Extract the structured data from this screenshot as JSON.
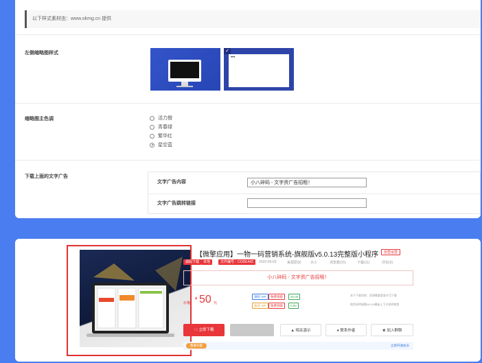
{
  "notice": "以下样式素材由：www.okmg.cn 提供",
  "thumb_style": {
    "label": "左侧缩略图样式"
  },
  "color_setting": {
    "label": "缩略图主色调",
    "options": [
      "活力橙",
      "青春绿",
      "繁华红",
      "星空蓝"
    ],
    "selected": "星空蓝"
  },
  "download_ad": {
    "label": "下载上面的文字广告",
    "content_label": "文字广告内容",
    "content_value": "小八碎码 - 文字资广告招租！",
    "link_label": "文字广告跳转链接",
    "link_value": ""
  },
  "product": {
    "title": "【微擎应用】一物一码营销系统-旗舰版v5.0.13完整版小程序",
    "status_badge": "自营运营",
    "tags": [
      "源码下载",
      "本地",
      "文件编号：CODE443"
    ],
    "meta": [
      "2020-06-03",
      "来源原创",
      "大小",
      "浏览数(25)",
      "下载(11)",
      "评论(0)"
    ],
    "ad_banner": "小八碎码 - 文字资广告招租！",
    "price_label": "价格",
    "price": "50",
    "price_unit": "元",
    "mini_tags": [
      "源码 VIP",
      "免费领取",
      "25.00",
      "会员 VIP",
      "免费领取",
      "0.00"
    ],
    "side_notes": [
      "关于下载须知：资源需要登录才可下载",
      "使用说明请看NO.08模板上下文说明使用"
    ],
    "buttons": [
      "立即下载",
      "",
      "相关演示",
      "联系作者",
      "加入群聊"
    ],
    "footer_chip": "我要升级",
    "footer_link": "立即开通会员"
  },
  "colors": {
    "page_bg": "#4a7df0",
    "accent_red": "#e8363a",
    "highlight_box": "#e03030",
    "thumb_blue": "#2d44a8"
  }
}
